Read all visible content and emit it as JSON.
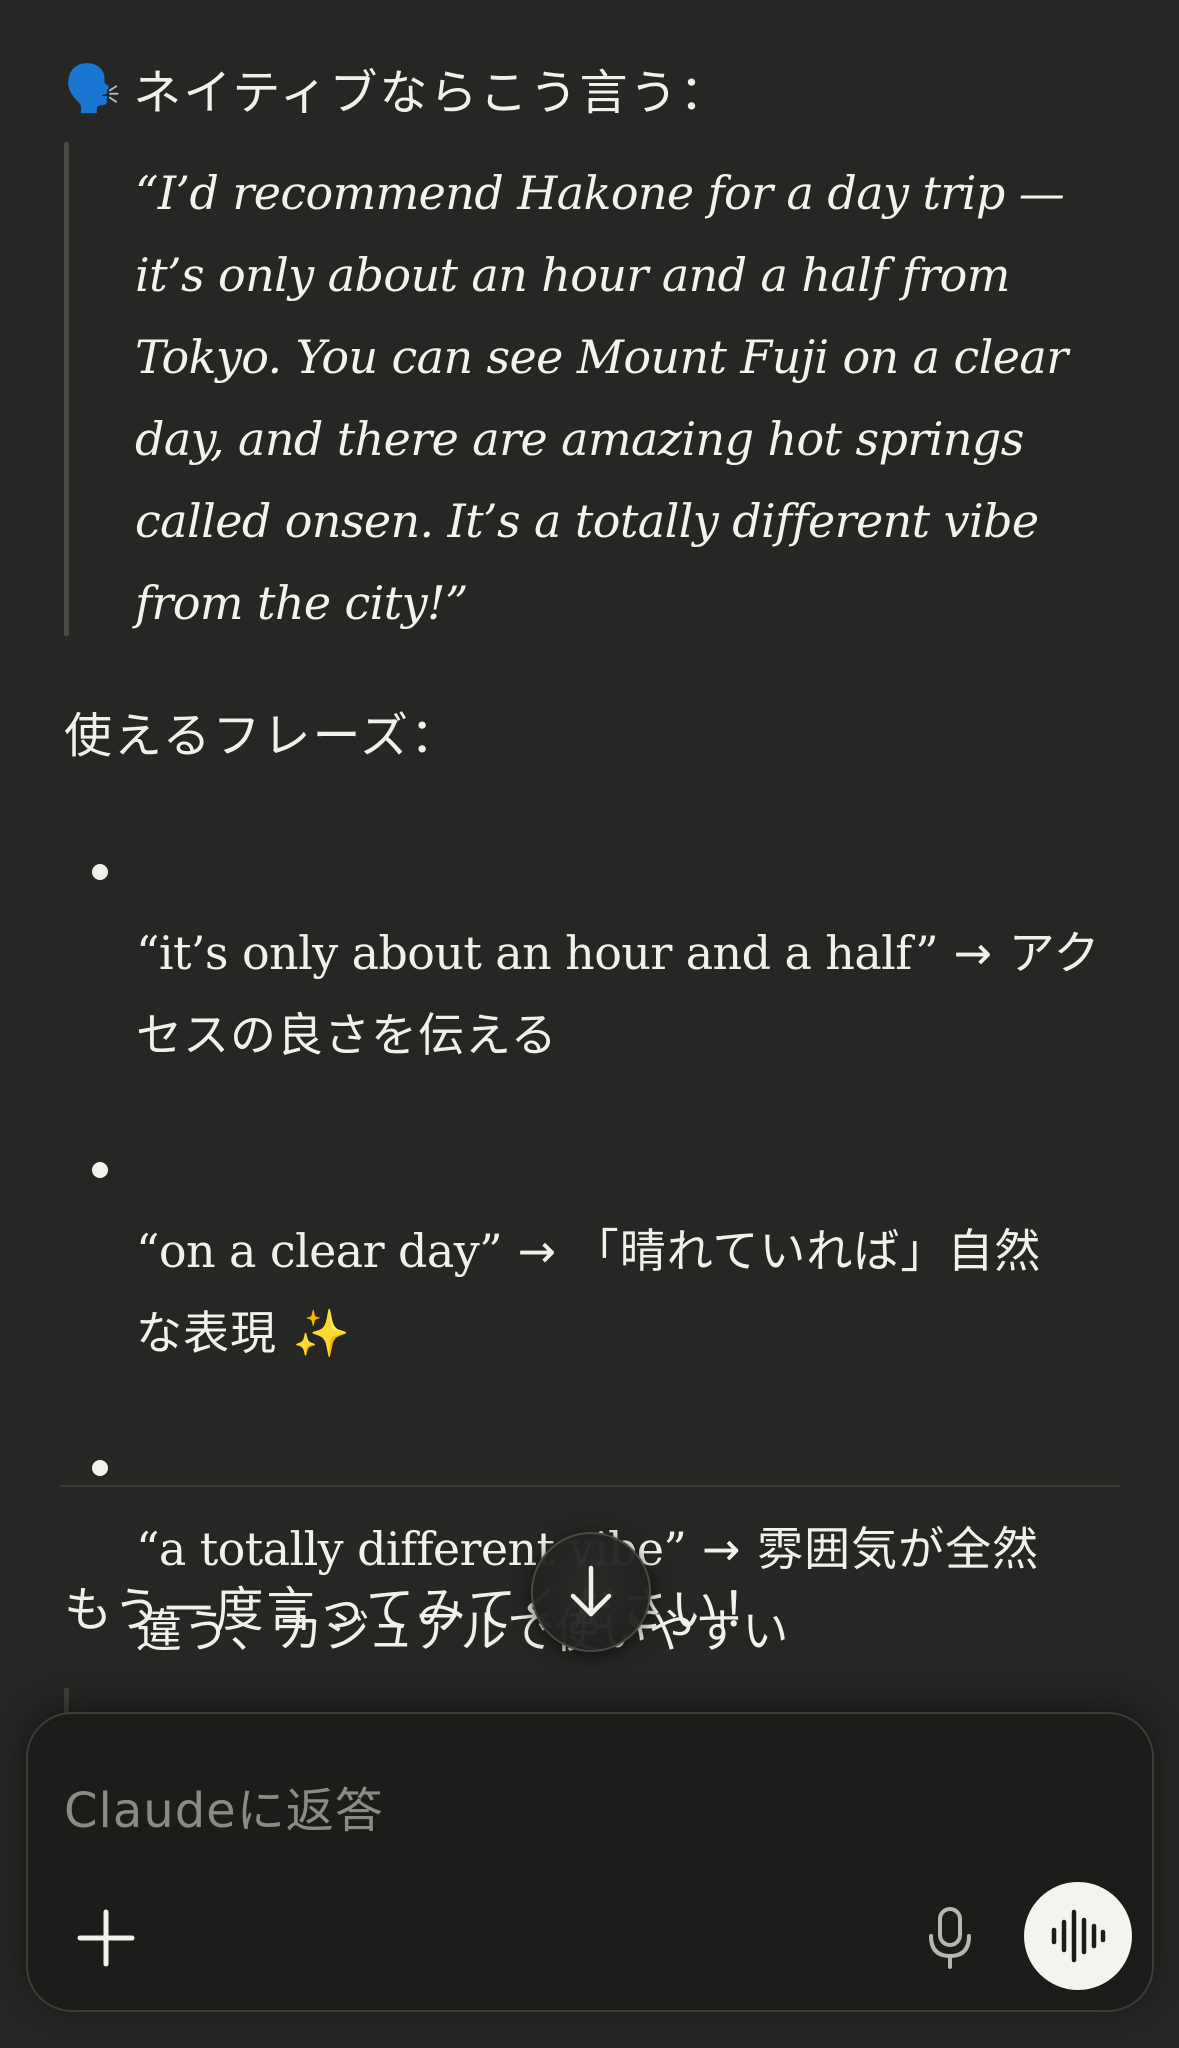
{
  "message": {
    "heading": {
      "icon": "speaking-head-icon",
      "emoji": "🗣️",
      "text": "ネイティブならこう言う："
    },
    "quote": "“I’d recommend Hakone for a day trip —\nit’s only about an hour and a half from\nTokyo. You can see Mount Fuji on a clear\nday, and there are amazing hot springs\ncalled onsen. It’s a totally different vibe\nfrom the city!”",
    "phrases_label": "使えるフレーズ：",
    "phrases": [
      {
        "en": "“it’s only about an hour and a half”",
        "ja": " → アク\nセスの良さを伝える"
      },
      {
        "en": "“on a clear day”",
        "ja": " → 「晴れていれば」自然\nな表現 ✨"
      },
      {
        "en": "“a totally different vibe”",
        "ja": " → 雰囲気が全然\n違う、カジュアルで使いやすい"
      }
    ],
    "try_again": "もう一度言ってみてください！"
  },
  "scroll_button": {
    "icon": "arrow-down-icon"
  },
  "composer": {
    "placeholder": "Claudeに返答",
    "value": "",
    "add_icon": "plus-icon",
    "mic_icon": "microphone-icon",
    "voice_icon": "voice-waveform-icon"
  },
  "colors": {
    "background": "#262624",
    "text": "#f2f0ea",
    "placeholder": "#8d8a82",
    "composer_bg": "#1c1c1a",
    "voice_button": "#f4f3ef"
  }
}
